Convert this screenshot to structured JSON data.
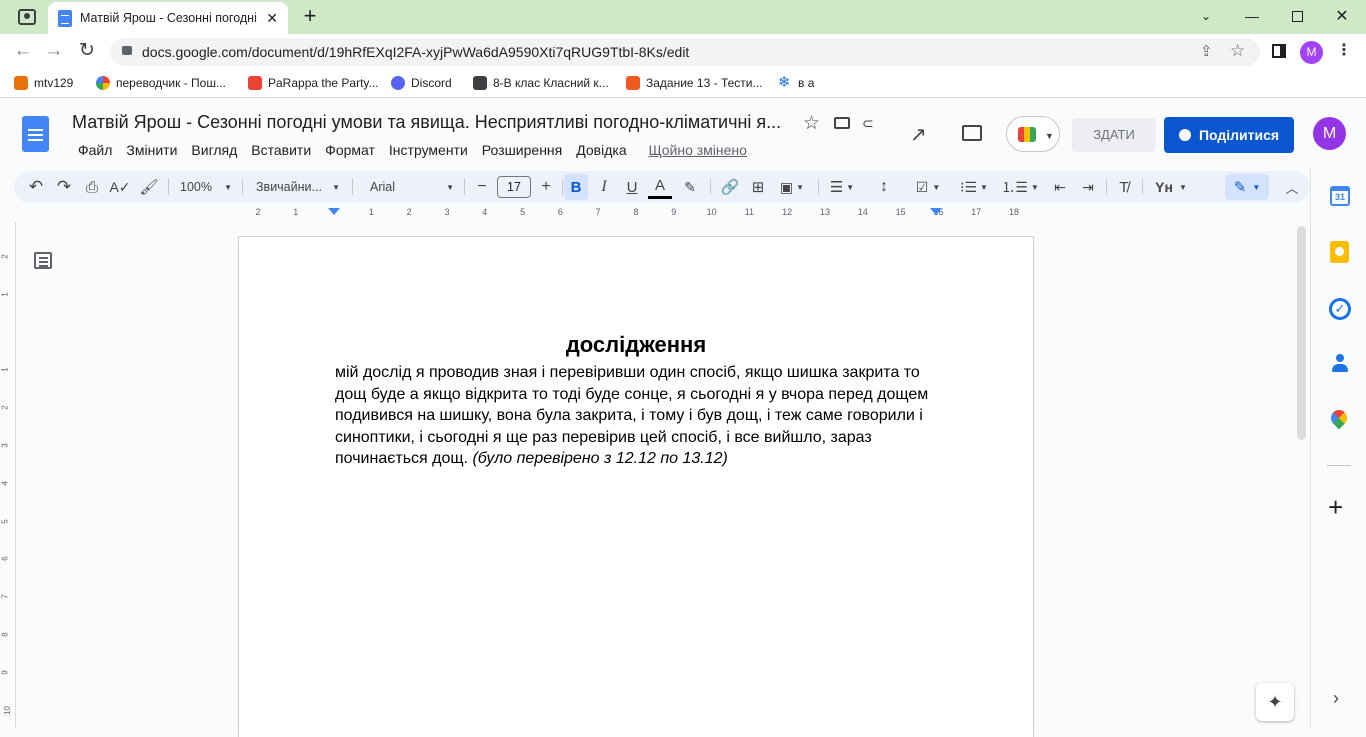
{
  "browser": {
    "tab_title": "Матвій Ярош - Сезонні погодні",
    "address": "docs.google.com/document/d/19hRfEXqI2FA-xyjPwWa6dA9590Xti7qRUG9TtbI-8Ks/edit",
    "profile_initial": "M",
    "bookmarks": [
      {
        "label": "mtv129",
        "color": "#e8710a"
      },
      {
        "label": "переводчик - Пош...",
        "color": "#4285f4"
      },
      {
        "label": "PaRappa the Party...",
        "color": "#ea4335"
      },
      {
        "label": "Discord",
        "color": "#5865f2"
      },
      {
        "label": "8-В клас Класний к...",
        "color": "#3c4043"
      },
      {
        "label": "Задание 13 - Тести...",
        "color": "#f05a22"
      },
      {
        "label": "в а",
        "color": "#1a73e8"
      }
    ]
  },
  "docs": {
    "title": "Матвій Ярош - Сезонні погодні умови та явища. Несприятливі погодно-кліматичні я...",
    "menu": [
      "Файл",
      "Змінити",
      "Вигляд",
      "Вставити",
      "Формат",
      "Інструменти",
      "Розширення",
      "Довідка"
    ],
    "last_edit": "Щойно змінено",
    "submit_label": "ЗДАТИ",
    "share_label": "Поділитися",
    "account_initial": "M"
  },
  "toolbar": {
    "zoom": "100%",
    "style": "Звичайни...",
    "font": "Arial",
    "font_size": "17"
  },
  "ruler": {
    "ticks": [
      "2",
      "1",
      "",
      "1",
      "2",
      "3",
      "4",
      "5",
      "6",
      "7",
      "8",
      "9",
      "10",
      "11",
      "12",
      "13",
      "14",
      "15",
      "16",
      "17",
      "18"
    ],
    "vticks": [
      "2",
      "1",
      "",
      "1",
      "2",
      "3",
      "4",
      "5",
      "6",
      "7",
      "8",
      "9",
      "10"
    ]
  },
  "document": {
    "heading": "дослідження",
    "body": "мій дослід я проводив зная і перевіривши один спосіб, якщо шишка закрита то дощ буде а якщо відкрита то тоді буде сонце, я сьогодні я у вчора перед дощем подивився на шишку, вона була закрита, і тому і був дощ, і теж саме говорили і синоптики, і сьогодні я ще раз перевірив цей спосіб, і все вийшло, зараз починається дощ.",
    "note": "(було перевірено з 12.12 по 13.12)"
  },
  "colors": {
    "tab_strip": "#cfe8c6",
    "share_button": "#0b57d0",
    "avatar": "#9334e6",
    "docs_blue": "#4285f4"
  }
}
